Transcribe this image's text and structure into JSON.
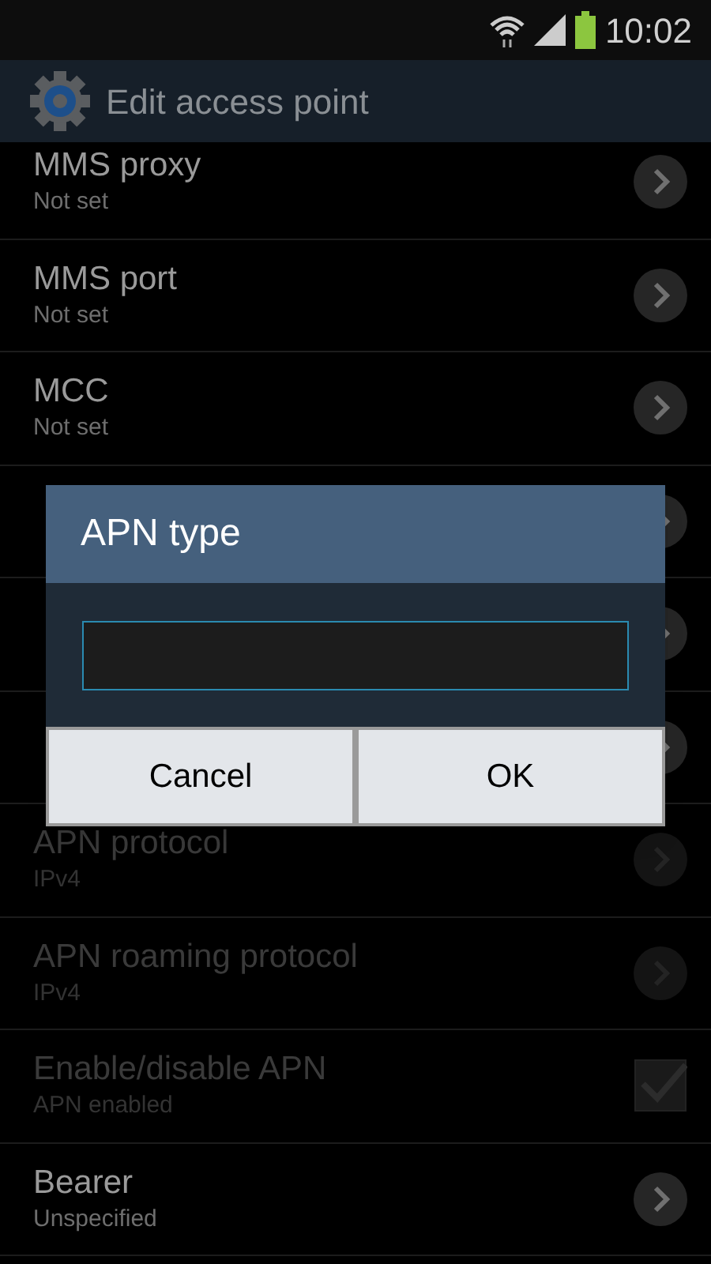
{
  "status_bar": {
    "time": "10:02"
  },
  "action_bar": {
    "title": "Edit access point"
  },
  "settings": [
    {
      "kind": "arrow",
      "title": "MMS proxy",
      "subtitle": "Not set",
      "disabled": false
    },
    {
      "kind": "arrow",
      "title": "MMS port",
      "subtitle": "Not set",
      "disabled": false
    },
    {
      "kind": "arrow",
      "title": "MCC",
      "subtitle": "Not set",
      "disabled": false
    },
    {
      "kind": "arrow",
      "disabled": false
    },
    {
      "kind": "arrow",
      "disabled": false
    },
    {
      "kind": "arrow",
      "disabled": false
    },
    {
      "kind": "arrow",
      "title": "APN protocol",
      "subtitle": "IPv4",
      "disabled": true
    },
    {
      "kind": "arrow",
      "title": "APN roaming protocol",
      "subtitle": "IPv4",
      "disabled": true
    },
    {
      "kind": "checkbox",
      "title": "Enable/disable APN",
      "subtitle": "APN enabled",
      "disabled": true,
      "checked": true
    },
    {
      "kind": "arrow",
      "title": "Bearer",
      "subtitle": "Unspecified",
      "disabled": false
    }
  ],
  "dialog": {
    "title": "APN type",
    "buttons": [
      "Cancel",
      "OK"
    ]
  }
}
